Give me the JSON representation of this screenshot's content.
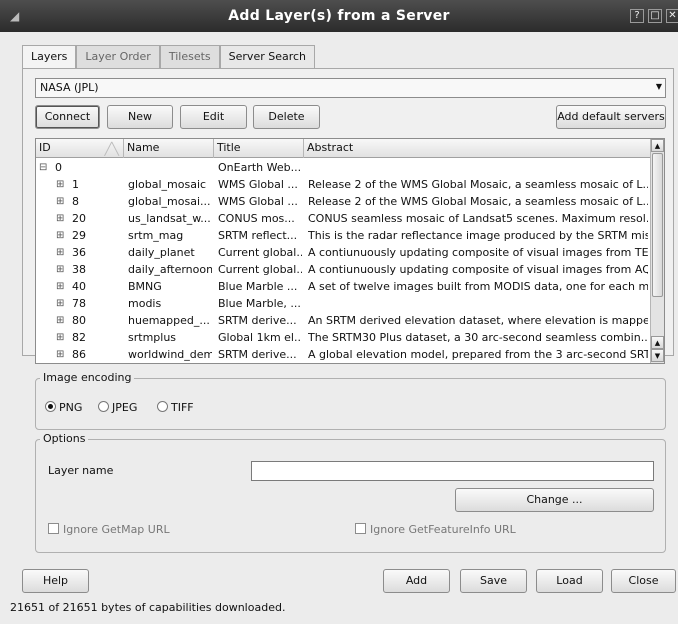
{
  "window": {
    "title": "Add Layer(s) from a Server",
    "help_btn": "?",
    "max_btn": "□",
    "close_btn": "✕"
  },
  "tabs": [
    {
      "label": "Layers"
    },
    {
      "label": "Layer Order"
    },
    {
      "label": "Tilesets"
    },
    {
      "label": "Server Search"
    }
  ],
  "server": {
    "selected": "NASA (JPL)"
  },
  "buttons": {
    "connect": "Connect",
    "new": "New",
    "edit": "Edit",
    "delete": "Delete",
    "add_default": "Add default servers"
  },
  "table": {
    "columns": [
      "ID",
      "Name",
      "Title",
      "Abstract"
    ],
    "rows": [
      {
        "id": "0",
        "name": "",
        "title": "OnEarth Web...",
        "abstract": ""
      },
      {
        "id": "1",
        "name": "global_mosaic",
        "title": "WMS Global ...",
        "abstract": "Release 2 of the WMS Global Mosaic, a seamless mosaic of L..."
      },
      {
        "id": "8",
        "name": "global_mosai...",
        "title": "WMS Global ...",
        "abstract": "Release 2 of the WMS Global Mosaic, a seamless mosaic of L..."
      },
      {
        "id": "20",
        "name": "us_landsat_w...",
        "title": "CONUS mos...",
        "abstract": "CONUS seamless mosaic of Landsat5 scenes. Maximum resol..."
      },
      {
        "id": "29",
        "name": "srtm_mag",
        "title": "SRTM reflect...",
        "abstract": "This is the radar reflectance image produced by the SRTM mis..."
      },
      {
        "id": "36",
        "name": "daily_planet",
        "title": "Current global...",
        "abstract": "A contiunuously updating composite of visual images from TER..."
      },
      {
        "id": "38",
        "name": "daily_afternoon",
        "title": "Current global...",
        "abstract": "A contiunuously updating composite of visual images from AQU..."
      },
      {
        "id": "40",
        "name": "BMNG",
        "title": "Blue Marble ...",
        "abstract": "A set of twelve images built from MODIS data, one for each m..."
      },
      {
        "id": "78",
        "name": "modis",
        "title": "Blue Marble, ...",
        "abstract": ""
      },
      {
        "id": "80",
        "name": "huemapped_...",
        "title": "SRTM derive...",
        "abstract": "An SRTM derived elevation dataset, where elevation is mappe..."
      },
      {
        "id": "82",
        "name": "srtmplus",
        "title": "Global 1km el...",
        "abstract": "The SRTM30 Plus dataset, a 30 arc-second seamless combin..."
      },
      {
        "id": "86",
        "name": "worldwind_dem",
        "title": "SRTM derive...",
        "abstract": "A global elevation model, prepared from the 3 arc-second SRT..."
      }
    ]
  },
  "encoding": {
    "legend": "Image encoding",
    "options": [
      "PNG",
      "JPEG",
      "TIFF"
    ],
    "selected": "PNG"
  },
  "options": {
    "legend": "Options",
    "layer_name_label": "Layer name",
    "layer_name_value": "",
    "change_btn": "Change ...",
    "ignore_getmap": "Ignore GetMap URL",
    "ignore_getfeatureinfo": "Ignore GetFeatureInfo URL"
  },
  "footer": {
    "help": "Help",
    "add": "Add",
    "save": "Save",
    "load": "Load",
    "close": "Close"
  },
  "status": "21651 of 21651 bytes of capabilities downloaded."
}
